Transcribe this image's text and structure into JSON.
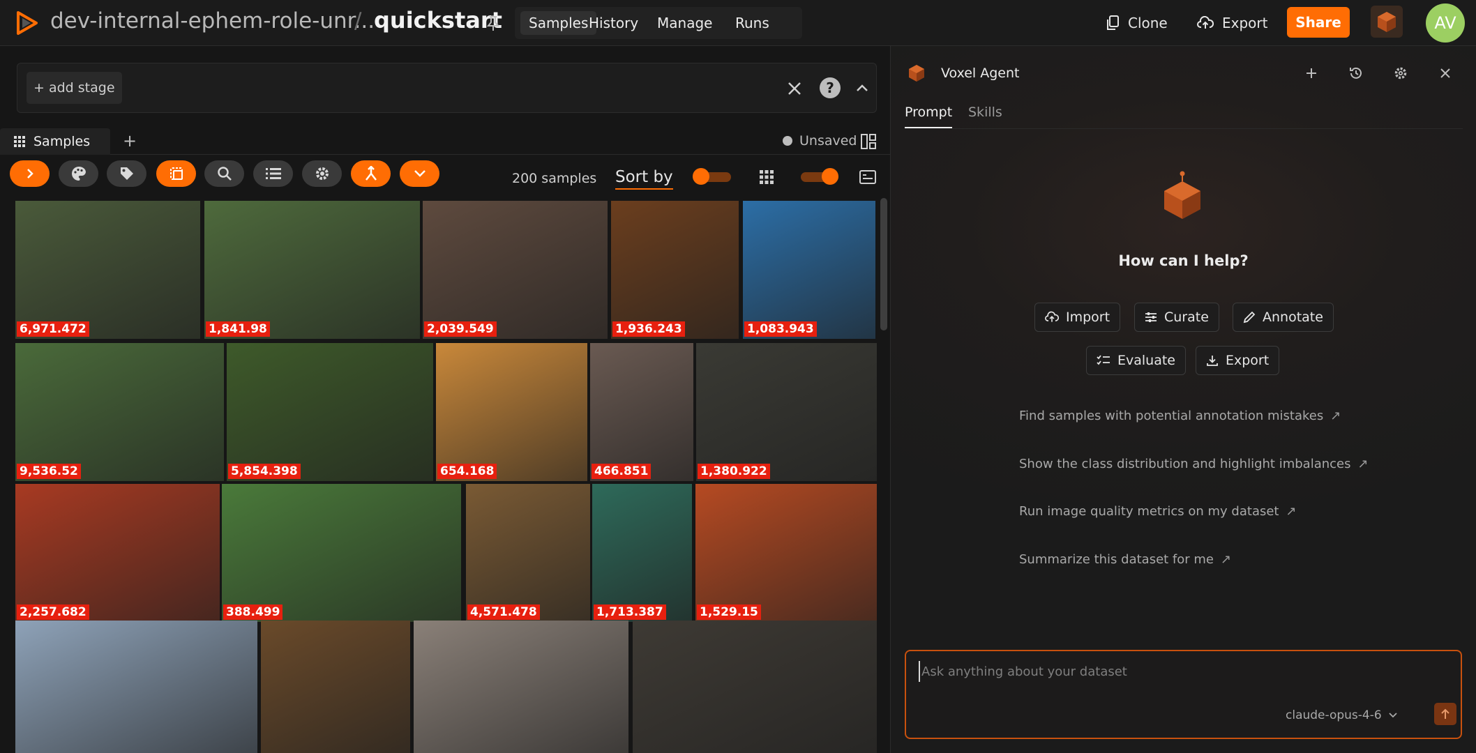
{
  "topbar": {
    "dataset_name": "dev-internal-ephem-role-unr...",
    "separator": "/",
    "view_name": "quickstart",
    "nav_tabs": [
      {
        "label": "Samples",
        "active": true
      },
      {
        "label": "History",
        "active": false
      },
      {
        "label": "Manage",
        "active": false
      },
      {
        "label": "Runs",
        "active": false
      }
    ],
    "clone_label": "Clone",
    "export_label": "Export",
    "share_label": "Share",
    "avatar_initials": "AV",
    "accent_color": "#ff6d04"
  },
  "view_bar": {
    "add_stage_label": "+ add stage",
    "help_label": "?"
  },
  "panel_tabs": {
    "samples_label": "Samples",
    "add_label": "+",
    "unsaved_label": "Unsaved"
  },
  "toolbar": {
    "sample_count": "200 samples",
    "sort_by_label": "Sort by",
    "icons": [
      "chevron-right-icon",
      "palette-icon",
      "tag-icon",
      "selection-icon",
      "search-icon",
      "list-icon",
      "gear-icon",
      "merge-icon",
      "chevron-down-icon"
    ]
  },
  "grid": {
    "tiles": [
      {
        "value": "6,971.472",
        "color": "#4a5a3a"
      },
      {
        "value": "1,841.98",
        "color": "#4e6a3c"
      },
      {
        "value": "2,039.549",
        "color": "#5e4a3e"
      },
      {
        "value": "1,936.243",
        "color": "#6b3e1e"
      },
      {
        "value": "1,083.943",
        "color": "#2c6ea6"
      },
      {
        "value": "9,536.52",
        "color": "#4a6a3a"
      },
      {
        "value": "5,854.398",
        "color": "#3e5a2a"
      },
      {
        "value": "654.168",
        "color": "#c9883a"
      },
      {
        "value": "466.851",
        "color": "#6a5a52"
      },
      {
        "value": "1,380.922",
        "color": "#3a3a34"
      },
      {
        "value": "2,257.682",
        "color": "#a83a22"
      },
      {
        "value": "388.499",
        "color": "#4a7a3a"
      },
      {
        "value": "4,571.478",
        "color": "#7a5a34"
      },
      {
        "value": "1,713.387",
        "color": "#2e6a5a"
      },
      {
        "value": "1,529.15",
        "color": "#b64a22"
      },
      {
        "value": "",
        "color": "#8ea2b8"
      },
      {
        "value": "",
        "color": "#6a4a2a"
      },
      {
        "value": "",
        "color": "#8a8078"
      },
      {
        "value": "",
        "color": "#3e3a34"
      }
    ]
  },
  "agent": {
    "title": "Voxel Agent",
    "tabs": [
      {
        "label": "Prompt",
        "active": true
      },
      {
        "label": "Skills",
        "active": false
      }
    ],
    "help_text": "How can I help?",
    "quick_actions": [
      {
        "label": "Import",
        "icon": "cloud-upload-icon"
      },
      {
        "label": "Curate",
        "icon": "sliders-icon"
      },
      {
        "label": "Annotate",
        "icon": "pencil-icon"
      },
      {
        "label": "Evaluate",
        "icon": "checklist-icon"
      },
      {
        "label": "Export",
        "icon": "download-icon"
      }
    ],
    "suggestions": [
      {
        "label": "Find samples with potential annotation mistakes",
        "arrow": "↗"
      },
      {
        "label": "Show the class distribution and highlight imbalances",
        "arrow": "↗"
      },
      {
        "label": "Run image quality metrics on my dataset",
        "arrow": "↗"
      },
      {
        "label": "Summarize this dataset for me",
        "arrow": "↗"
      }
    ],
    "prompt_placeholder": "Ask anything about your dataset",
    "model_name": "claude-opus-4-6"
  }
}
